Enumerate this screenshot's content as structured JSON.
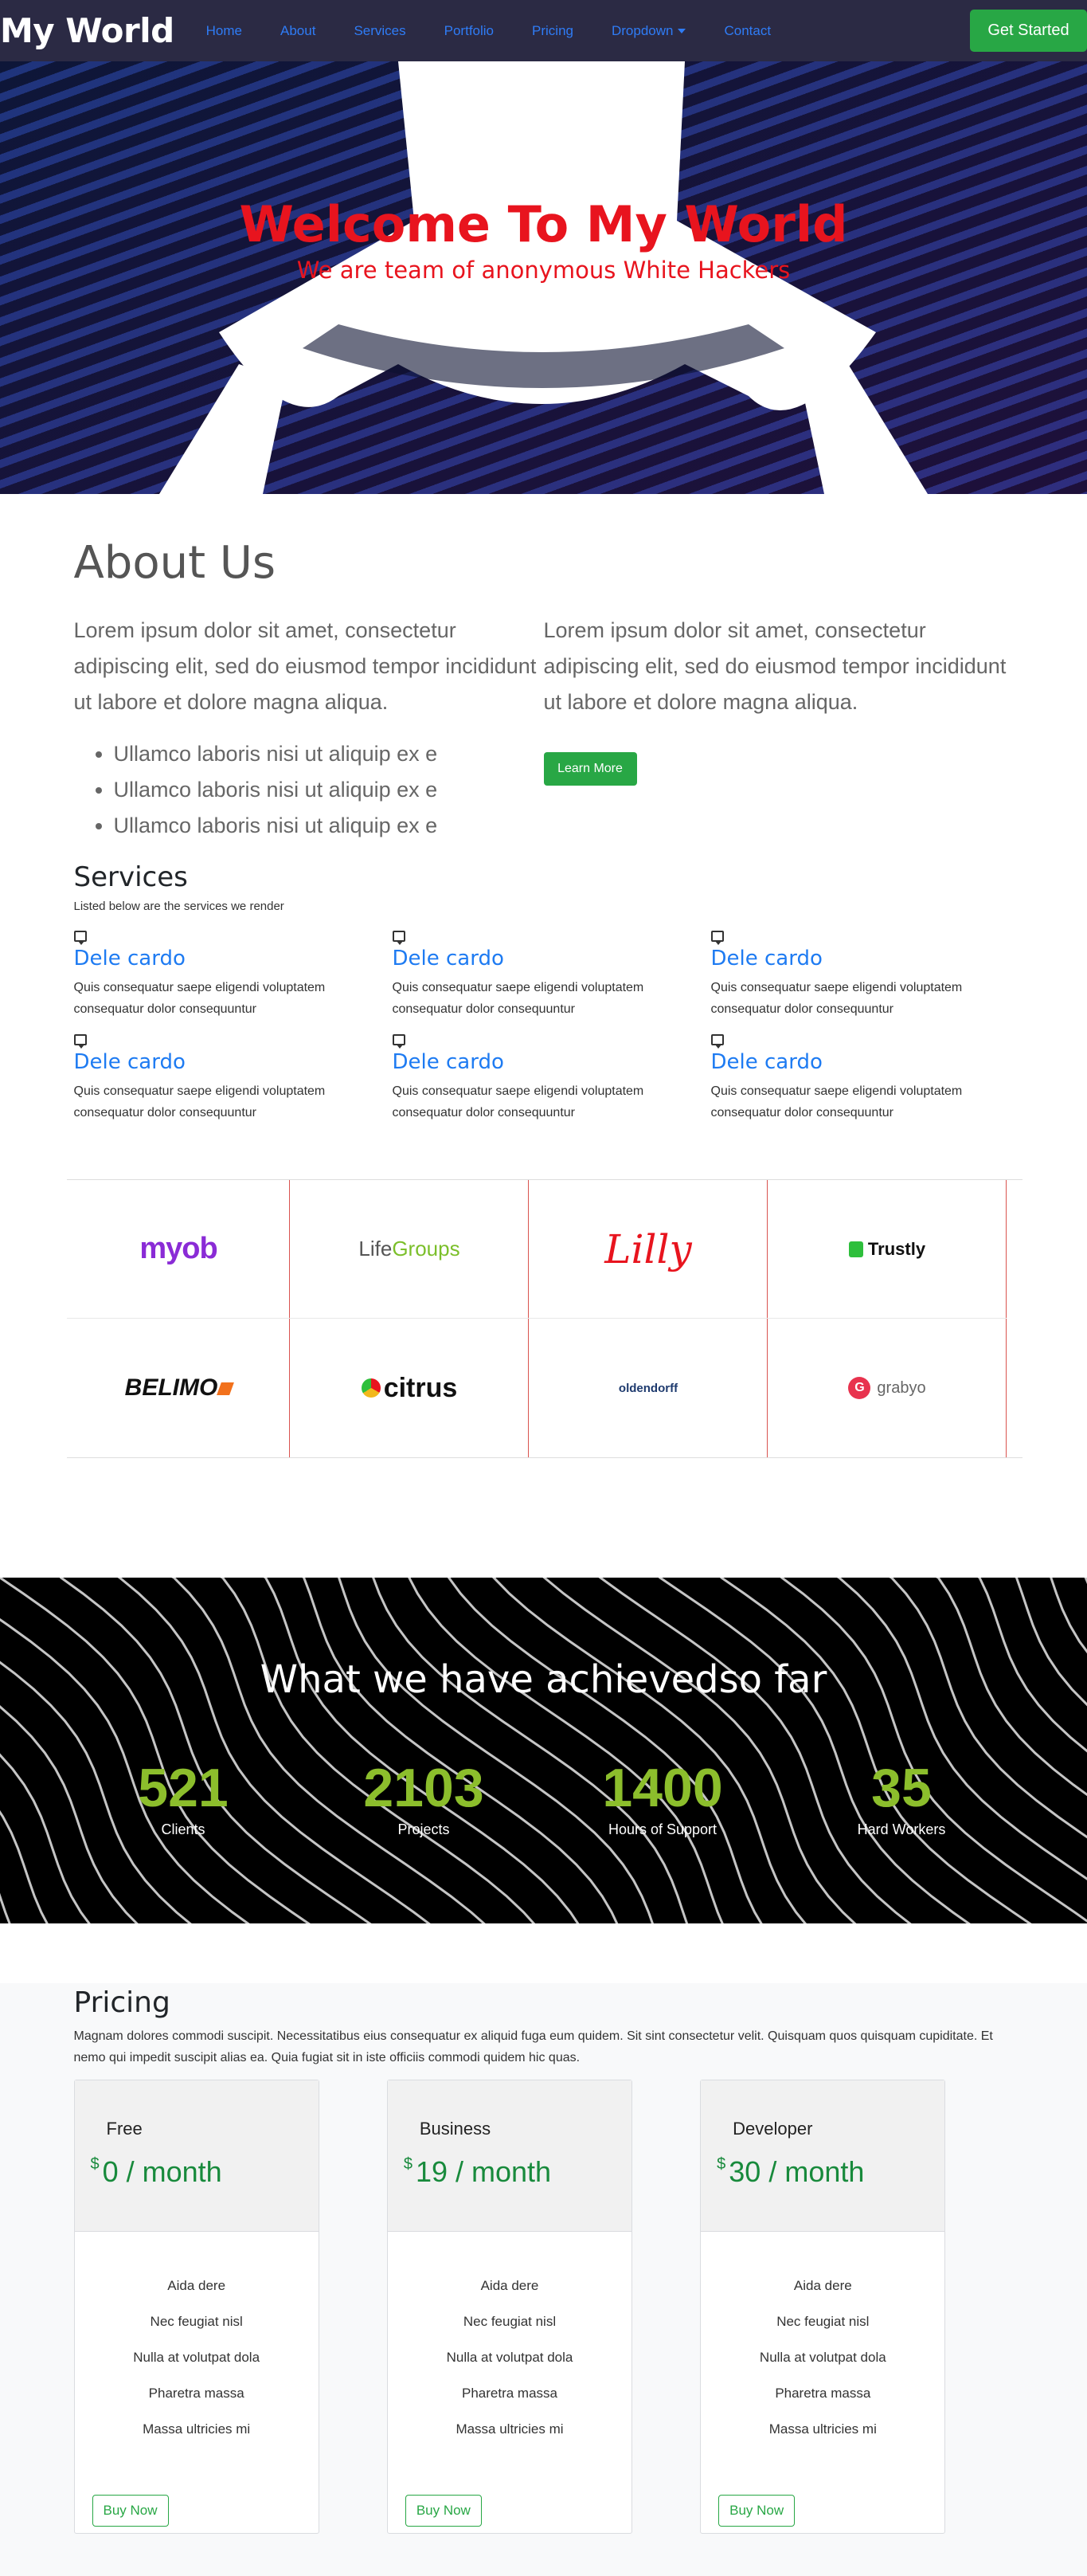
{
  "brand": "My World",
  "nav": {
    "items": [
      "Home",
      "About",
      "Services",
      "Portfolio",
      "Pricing",
      "Dropdown",
      "Contact"
    ],
    "cta": "Get Started"
  },
  "hero": {
    "title": "Welcome To My World",
    "subtitle": "We are team of anonymous White Hackers"
  },
  "about": {
    "heading": "About Us",
    "left_text": "Lorem ipsum dolor sit amet, consectetur adipiscing elit, sed do eiusmod tempor incididunt ut labore et dolore magna aliqua.",
    "bullets": [
      "Ullamco laboris nisi ut aliquip ex e",
      "Ullamco laboris nisi ut aliquip ex e",
      "Ullamco laboris nisi ut aliquip ex e"
    ],
    "right_text": "Lorem ipsum dolor sit amet, consectetur adipiscing elit, sed do eiusmod tempor incididunt ut labore et dolore magna aliqua.",
    "button": "Learn More"
  },
  "services": {
    "heading": "Services",
    "lead": "Listed below are the services we render",
    "items": [
      {
        "title": "Dele cardo",
        "desc": "Quis consequatur saepe eligendi voluptatem consequatur dolor consequuntur"
      },
      {
        "title": "Dele cardo",
        "desc": "Quis consequatur saepe eligendi voluptatem consequatur dolor consequuntur"
      },
      {
        "title": "Dele cardo",
        "desc": "Quis consequatur saepe eligendi voluptatem consequatur dolor consequuntur"
      },
      {
        "title": "Dele cardo",
        "desc": "Quis consequatur saepe eligendi voluptatem consequatur dolor consequuntur"
      },
      {
        "title": "Dele cardo",
        "desc": "Quis consequatur saepe eligendi voluptatem consequatur dolor consequuntur"
      },
      {
        "title": "Dele cardo",
        "desc": "Quis consequatur saepe eligendi voluptatem consequatur dolor consequuntur"
      }
    ]
  },
  "clients": {
    "myob": "myob",
    "life_a": "Life",
    "life_b": "Groups",
    "lilly": "Lilly",
    "trustly": "Trustly",
    "belimo": "BELIMO",
    "citrus": "citrus",
    "oldendorff": "oldendorff",
    "grabyo": "grabyo"
  },
  "achievements": {
    "heading": "What we have achievedso far",
    "stats": [
      {
        "value": "521",
        "label": "Clients"
      },
      {
        "value": "2103",
        "label": "Projects"
      },
      {
        "value": "1400",
        "label": "Hours of Support"
      },
      {
        "value": "35",
        "label": "Hard Workers"
      }
    ]
  },
  "pricing": {
    "heading": "Pricing",
    "desc": "Magnam dolores commodi suscipit. Necessitatibus eius consequatur ex aliquid fuga eum quidem. Sit sint consectetur velit. Quisquam quos quisquam cupiditate. Et nemo qui impedit suscipit alias ea. Quia fugiat sit in iste officiis commodi quidem hic quas.",
    "currency": "$",
    "plans": [
      {
        "name": "Free",
        "price": "0 / month"
      },
      {
        "name": "Business",
        "price": "19 / month"
      },
      {
        "name": "Developer",
        "price": "30 / month"
      }
    ],
    "features": [
      "Aida dere",
      "Nec feugiat nisl",
      "Nulla at volutpat dola",
      "Pharetra massa",
      "Massa ultricies mi"
    ],
    "button": "Buy Now"
  },
  "colors": {
    "navbar": "#2b2a44",
    "link": "#2f7cf6",
    "accent_green": "#28a745",
    "hero_text": "#e8141e",
    "stat_green": "#8cbe2c"
  }
}
